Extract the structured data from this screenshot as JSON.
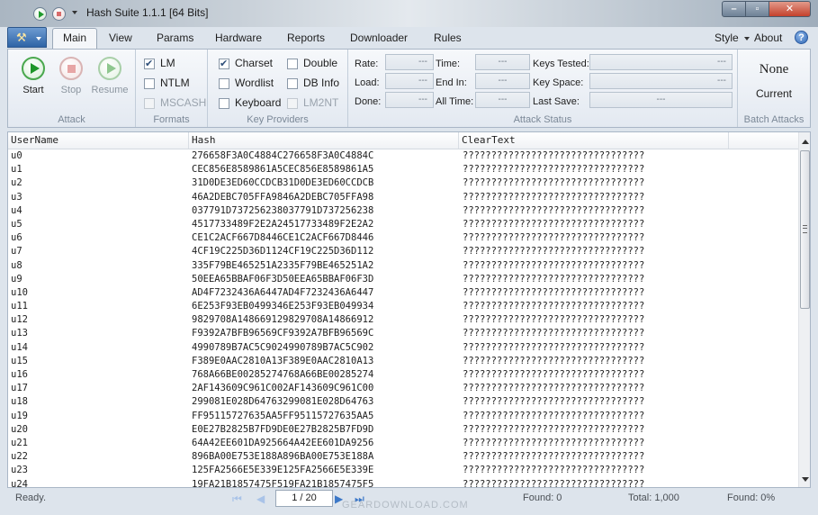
{
  "window": {
    "title": "Hash Suite 1.1.1 [64 Bits]"
  },
  "tabs": [
    "Main",
    "View",
    "Params",
    "Hardware",
    "Reports",
    "Downloader",
    "Rules"
  ],
  "right_menu": {
    "style": "Style",
    "about": "About",
    "help": "?"
  },
  "attack": {
    "start": "Start",
    "stop": "Stop",
    "resume": "Resume",
    "group": "Attack"
  },
  "formats": {
    "lm": "LM",
    "ntlm": "NTLM",
    "mscash": "MSCASH",
    "group": "Formats"
  },
  "key_providers": {
    "charset": "Charset",
    "wordlist": "Wordlist",
    "keyboard": "Keyboard",
    "double": "Double",
    "dbinfo": "DB Info",
    "lm2nt": "LM2NT",
    "group": "Key Providers"
  },
  "attack_status": {
    "rate_label": "Rate:",
    "rate": "---",
    "load_label": "Load:",
    "load": "---",
    "done_label": "Done:",
    "done": "---",
    "time_label": "Time:",
    "time": "---",
    "endin_label": "End In:",
    "endin": "---",
    "alltime_label": "All Time:",
    "alltime": "---",
    "keystested_label": "Keys Tested:",
    "keystested": "---",
    "keyspace_label": "Key Space:",
    "keyspace": "---",
    "lastsave_label": "Last Save:",
    "lastsave": "---",
    "group": "Attack Status"
  },
  "batch": {
    "none": "None",
    "current": "Current",
    "group": "Batch Attacks"
  },
  "table": {
    "columns": [
      "UserName",
      "Hash",
      "ClearText"
    ],
    "rows": [
      [
        "u0",
        "276658F3A0C4884C276658F3A0C4884C",
        "????????????????????????????????"
      ],
      [
        "u1",
        "CEC856E8589861A5CEC856E8589861A5",
        "????????????????????????????????"
      ],
      [
        "u2",
        "31D0DE3ED60CCDCB31D0DE3ED60CCDCB",
        "????????????????????????????????"
      ],
      [
        "u3",
        "46A2DEBC705FFA9846A2DEBC705FFA98",
        "????????????????????????????????"
      ],
      [
        "u4",
        "037791D737256238037791D737256238",
        "????????????????????????????????"
      ],
      [
        "u5",
        "4517733489F2E2A24517733489F2E2A2",
        "????????????????????????????????"
      ],
      [
        "u6",
        "CE1C2ACF667D8446CE1C2ACF667D8446",
        "????????????????????????????????"
      ],
      [
        "u7",
        "4CF19C225D36D1124CF19C225D36D112",
        "????????????????????????????????"
      ],
      [
        "u8",
        "335F79BE465251A2335F79BE465251A2",
        "????????????????????????????????"
      ],
      [
        "u9",
        "50EEA65BBAF06F3D50EEA65BBAF06F3D",
        "????????????????????????????????"
      ],
      [
        "u10",
        "AD4F7232436A6447AD4F7232436A6447",
        "????????????????????????????????"
      ],
      [
        "u11",
        "6E253F93EB0499346E253F93EB049934",
        "????????????????????????????????"
      ],
      [
        "u12",
        "9829708A148669129829708A14866912",
        "????????????????????????????????"
      ],
      [
        "u13",
        "F9392A7BFB96569CF9392A7BFB96569C",
        "????????????????????????????????"
      ],
      [
        "u14",
        "4990789B7AC5C9024990789B7AC5C902",
        "????????????????????????????????"
      ],
      [
        "u15",
        "F389E0AAC2810A13F389E0AAC2810A13",
        "????????????????????????????????"
      ],
      [
        "u16",
        "768A66BE00285274768A66BE00285274",
        "????????????????????????????????"
      ],
      [
        "u17",
        "2AF143609C961C002AF143609C961C00",
        "????????????????????????????????"
      ],
      [
        "u18",
        "299081E028D64763299081E028D64763",
        "????????????????????????????????"
      ],
      [
        "u19",
        "FF95115727635AA5FF95115727635AA5",
        "????????????????????????????????"
      ],
      [
        "u20",
        "E0E27B2825B7FD9DE0E27B2825B7FD9D",
        "????????????????????????????????"
      ],
      [
        "u21",
        "64A42EE601DA925664A42EE601DA9256",
        "????????????????????????????????"
      ],
      [
        "u22",
        "896BA00E753E188A896BA00E753E188A",
        "????????????????????????????????"
      ],
      [
        "u23",
        "125FA2566E5E339E125FA2566E5E339E",
        "????????????????????????????????"
      ],
      [
        "u24",
        "19FA21B1857475F519FA21B1857475F5",
        "????????????????????????????????"
      ]
    ]
  },
  "status": {
    "ready": "Ready.",
    "page": "1 / 20",
    "found": "Found: 0",
    "total": "Total: 1,000",
    "found_pct": "Found:  0%"
  },
  "watermark": "GEARDOWNLOAD.COM",
  "colors": {
    "accent": "#2f64a6",
    "start_green": "#1e9628",
    "ribbon_bg": "#e3e9f1"
  }
}
